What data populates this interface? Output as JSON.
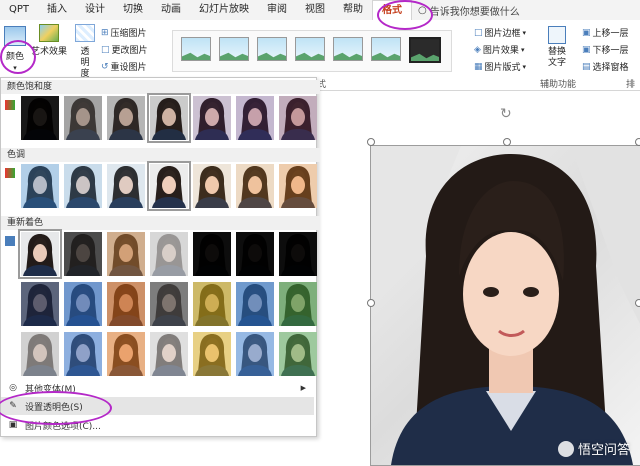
{
  "tabs": [
    "QPT",
    "插入",
    "设计",
    "切换",
    "动画",
    "幻灯片放映",
    "审阅",
    "视图",
    "帮助",
    "格式"
  ],
  "active_tab": "格式",
  "tell_me": "告诉我你想要做什么",
  "ribbon": {
    "color_label": "颜色",
    "artistic_label": "艺术效果",
    "transparency_label": "透明度",
    "compress": "压缩图片",
    "change": "更改图片",
    "reset": "重设图片",
    "picture_styles_group": "图片样式",
    "border": "图片边框",
    "effects": "图片效果",
    "layout": "图片版式",
    "alt_text": "替换文字",
    "accessibility_group": "辅助功能",
    "bring_forward": "上移一层",
    "send_backward": "下移一层",
    "selection_pane": "选择窗格",
    "arrange_group": "排列"
  },
  "menu": {
    "saturation_title": "颜色饱和度",
    "tone_title": "色调",
    "recolor_title": "重新着色",
    "more_variants": "其他变体(M)",
    "set_transparent": "设置透明色(S)",
    "color_options": "图片颜色选项(C)..."
  },
  "saturation_swatches": [
    {
      "tint": "#000000",
      "opacity": 0.9
    },
    {
      "tint": "#555555",
      "opacity": 0.5
    },
    {
      "tint": "#444444",
      "opacity": 0.35
    },
    {
      "tint": "#333333",
      "opacity": 0.2
    },
    {
      "tint": "#5a2f74",
      "opacity": 0.25
    },
    {
      "tint": "#5a2f7e",
      "opacity": 0.3
    },
    {
      "tint": "#6a2f5a",
      "opacity": 0.35
    }
  ],
  "tone_swatches": [
    {
      "tint": "#3b8fd6",
      "opacity": 0.35
    },
    {
      "tint": "#4f9ad8",
      "opacity": 0.25
    },
    {
      "tint": "#6aa8d8",
      "opacity": 0.15
    },
    {
      "tint": "#888888",
      "opacity": 0.05
    },
    {
      "tint": "#d89b4a",
      "opacity": 0.15
    },
    {
      "tint": "#e0933a",
      "opacity": 0.25
    },
    {
      "tint": "#e8862a",
      "opacity": 0.35
    }
  ],
  "recolor_swatches": [
    {
      "tint": "#2a3f6b",
      "opacity": 0.05
    },
    {
      "tint": "#222222",
      "opacity": 0.8
    },
    {
      "tint": "#b5763c",
      "opacity": 0.55
    },
    {
      "tint": "#cccccc",
      "opacity": 0.7
    },
    {
      "tint": "#000000",
      "opacity": 0.95
    },
    {
      "tint": "#000000",
      "opacity": 0.95
    },
    {
      "tint": "#000000",
      "opacity": 0.95
    },
    {
      "tint": "#1c2a4a",
      "opacity": 0.7
    },
    {
      "tint": "#2a66b8",
      "opacity": 0.65
    },
    {
      "tint": "#b85a1c",
      "opacity": 0.65
    },
    {
      "tint": "#4c4c4c",
      "opacity": 0.7
    },
    {
      "tint": "#b89a1c",
      "opacity": 0.65
    },
    {
      "tint": "#2a6ab8",
      "opacity": 0.65
    },
    {
      "tint": "#3f8a3a",
      "opacity": 0.65
    },
    {
      "tint": "#bbbbbb",
      "opacity": 0.6
    },
    {
      "tint": "#3a78d0",
      "opacity": 0.55
    },
    {
      "tint": "#e07a2a",
      "opacity": 0.55
    },
    {
      "tint": "#cfcfcf",
      "opacity": 0.55
    },
    {
      "tint": "#e0b42a",
      "opacity": 0.55
    },
    {
      "tint": "#4a8ad8",
      "opacity": 0.55
    },
    {
      "tint": "#5aa85a",
      "opacity": 0.55
    }
  ],
  "watermark": "悟空问答"
}
